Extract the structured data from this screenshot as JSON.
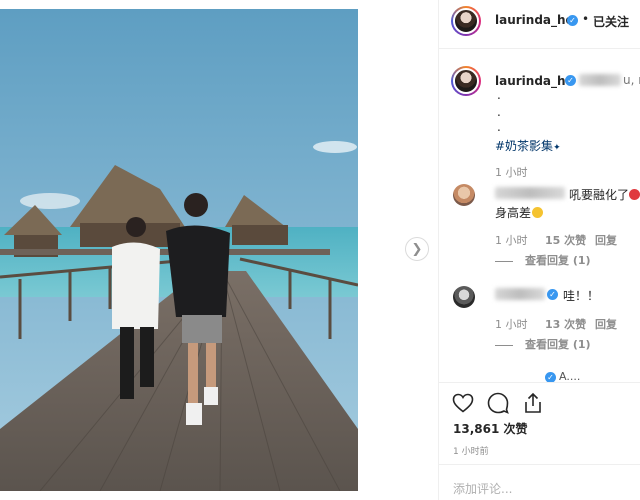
{
  "post": {
    "author": "laurinda_ho",
    "follow_status": "已关注",
    "separator": "•"
  },
  "caption": {
    "author": "laurinda_ho",
    "blurred_tail": "u, n",
    "dots": [
      ".",
      ".",
      "."
    ],
    "hashtag": "#奶茶影集",
    "time": "1 小时"
  },
  "comments": [
    {
      "text_line1": "吼要融化了",
      "text_line2": "身高差",
      "time": "1 小时",
      "likes": "15 次赞",
      "reply": "回复",
      "view_replies": "查看回复 (1)"
    },
    {
      "text_line1": "哇！！",
      "time": "1 小时",
      "likes": "13 次赞",
      "reply": "回复",
      "view_replies": "查看回复 (1)"
    }
  ],
  "partial_comment_text": "A....",
  "actions": {
    "like_icon": "heart-icon",
    "comment_icon": "comment-icon",
    "share_icon": "share-icon"
  },
  "likes_count": "13,861",
  "likes_suffix": "次赞",
  "posted_time": "1 小时前",
  "add_comment_placeholder": "添加评论...",
  "colors": {
    "verified": "#3897f0",
    "link": "#003569",
    "muted": "#8e8e8e",
    "divider": "#efefef"
  }
}
